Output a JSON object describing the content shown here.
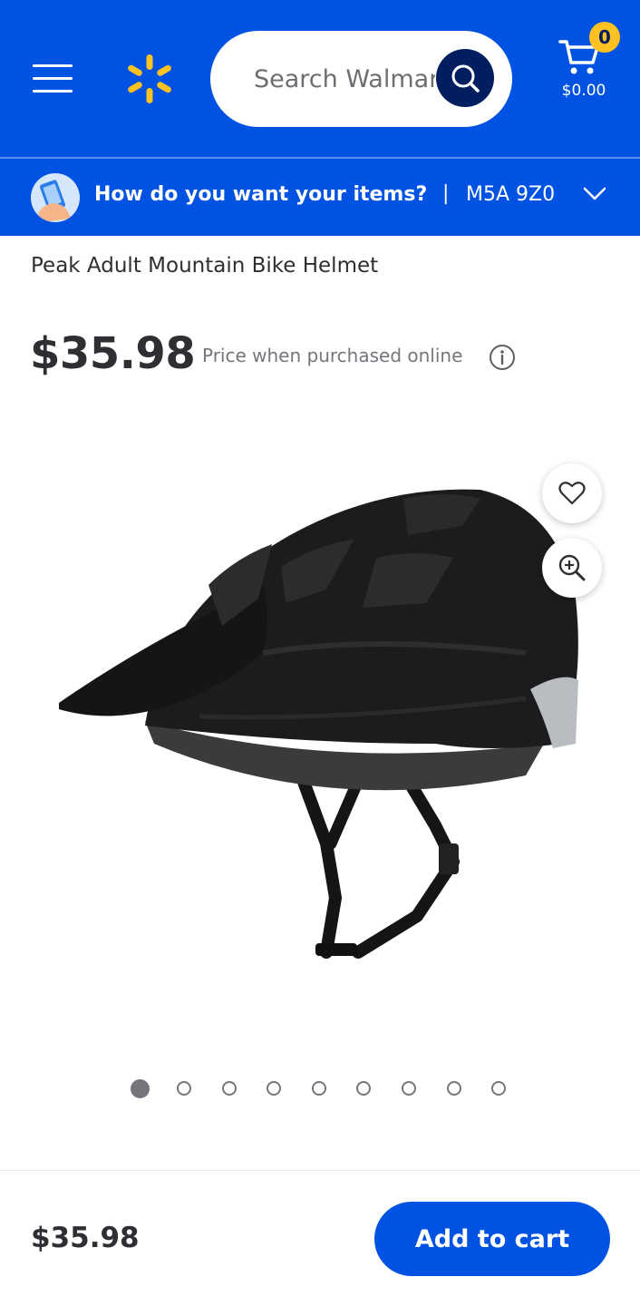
{
  "header": {
    "menu_icon": "hamburger-menu-icon",
    "logo_icon": "walmart-spark-icon",
    "search_placeholder": "Search Walmart",
    "search_icon": "search-icon",
    "cart_icon": "shopping-cart-icon",
    "cart_count": "0",
    "cart_total": "$0.00"
  },
  "fulfillment": {
    "icon": "phone-in-hand-icon",
    "prompt": "How do you want your items?",
    "separator": "|",
    "postal_code": "M5A 9Z0",
    "chevron_icon": "chevron-down-icon"
  },
  "product": {
    "title": "Peak Adult Mountain Bike Helmet",
    "price": "$35.98",
    "price_note": "Price when purchased online",
    "info_icon": "info-icon",
    "favorite_icon": "heart-icon",
    "zoom_icon": "zoom-in-icon"
  },
  "carousel": {
    "total_images": 9,
    "active_index": 0
  },
  "bottom_bar": {
    "price": "$35.98",
    "add_to_cart_label": "Add to cart"
  },
  "colors": {
    "brand_blue": "#0053e2",
    "dark_blue": "#001e60",
    "spark_yellow": "#ffc220"
  }
}
